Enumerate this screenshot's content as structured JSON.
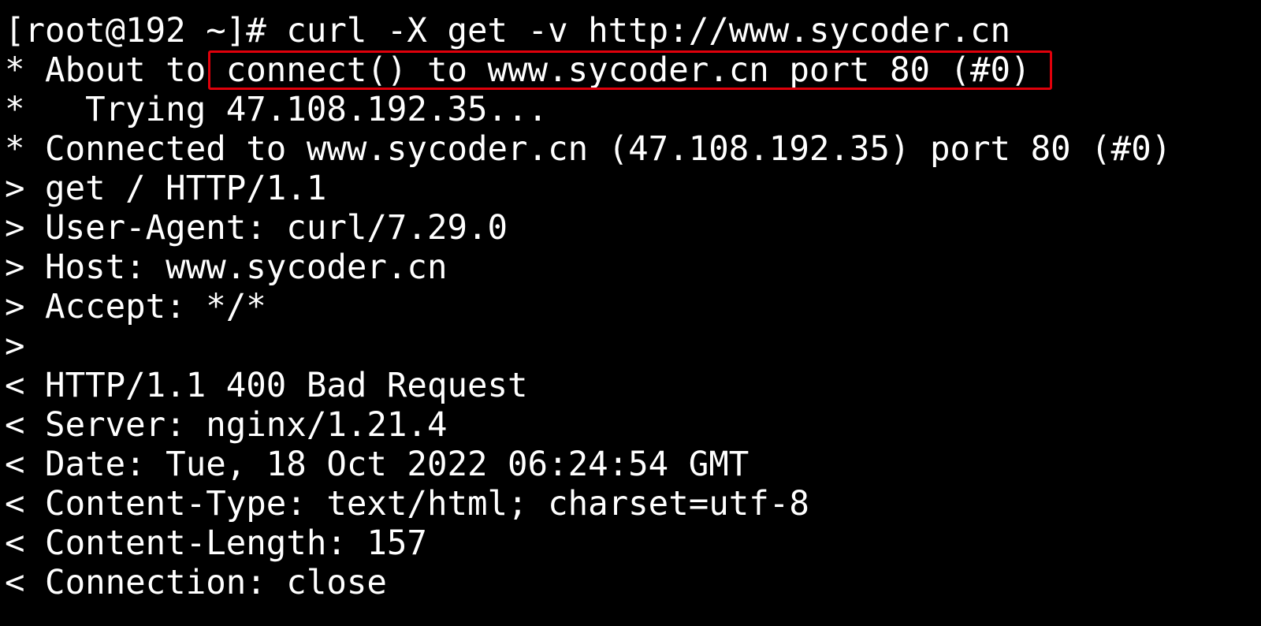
{
  "terminal": {
    "lines": [
      "[root@192 ~]# curl -X get -v http://www.sycoder.cn",
      "* About to connect() to www.sycoder.cn port 80 (#0)",
      "*   Trying 47.108.192.35...",
      "* Connected to www.sycoder.cn (47.108.192.35) port 80 (#0)",
      "> get / HTTP/1.1",
      "> User-Agent: curl/7.29.0",
      "> Host: www.sycoder.cn",
      "> Accept: */*",
      ">",
      "< HTTP/1.1 400 Bad Request",
      "< Server: nginx/1.21.4",
      "< Date: Tue, 18 Oct 2022 06:24:54 GMT",
      "< Content-Type: text/html; charset=utf-8",
      "< Content-Length: 157",
      "< Connection: close"
    ]
  },
  "colors": {
    "background": "#000000",
    "text": "#ffffff",
    "highlight": "#e0000b"
  }
}
